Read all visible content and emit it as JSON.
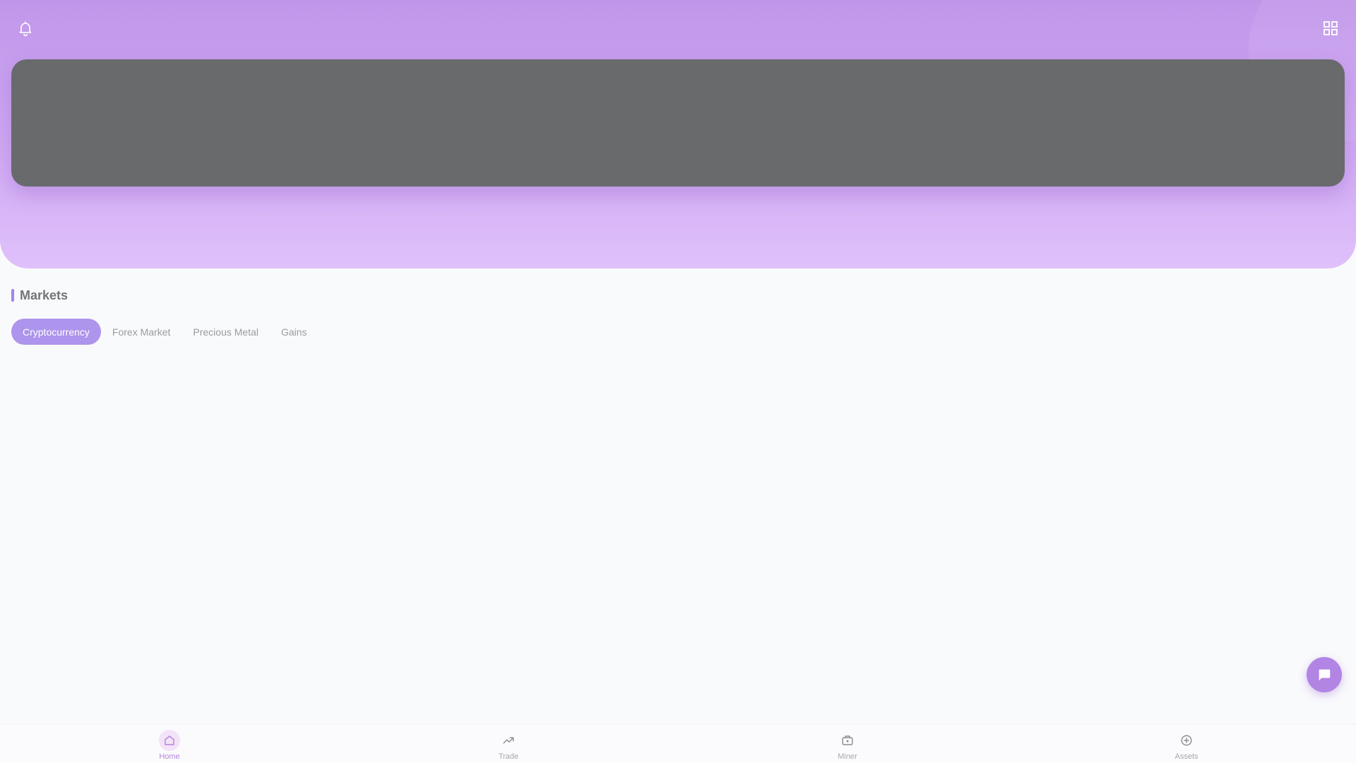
{
  "header": {
    "bell_icon": "bell-icon",
    "menu_icon": "grid-icon"
  },
  "banner": {
    "color": "#696a6c"
  },
  "markets": {
    "title": "Markets",
    "tabs": [
      {
        "label": "Cryptocurrency",
        "active": true
      },
      {
        "label": "Forex Market",
        "active": false
      },
      {
        "label": "Precious Metal",
        "active": false
      },
      {
        "label": "Gains",
        "active": false
      }
    ]
  },
  "chat_button": {
    "icon": "chat-icon"
  },
  "nav": {
    "items": [
      {
        "label": "Home",
        "icon": "home-icon",
        "active": true
      },
      {
        "label": "Trade",
        "icon": "trending-up-icon",
        "active": false
      },
      {
        "label": "Miner",
        "icon": "briefcase-icon",
        "active": false
      },
      {
        "label": "Assets",
        "icon": "plus-circle-icon",
        "active": false
      }
    ]
  },
  "colors": {
    "accent": "#ad94ec",
    "hero_top": "#c096ea",
    "hero_bottom": "#e0c0fb",
    "nav_active": "#b685dc",
    "background": "#f9fafc"
  }
}
